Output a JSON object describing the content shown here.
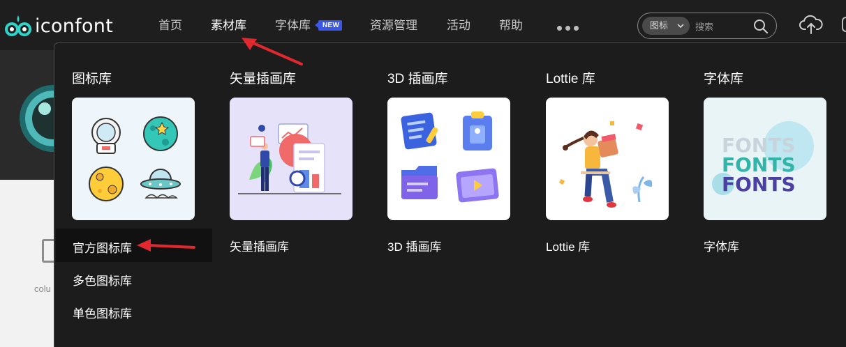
{
  "header": {
    "logo_text": "iconfont",
    "nav": [
      {
        "label": "首页",
        "active": false
      },
      {
        "label": "素材库",
        "active": true
      },
      {
        "label": "字体库",
        "active": false,
        "badge": "NEW"
      },
      {
        "label": "资源管理",
        "active": false
      },
      {
        "label": "活动",
        "active": false
      },
      {
        "label": "帮助",
        "active": false
      }
    ],
    "search": {
      "type_label": "图标",
      "placeholder": "搜索"
    }
  },
  "background_page": {
    "column_text": "colu"
  },
  "dropdown": {
    "columns": [
      {
        "title": "图标库",
        "icon": "icon-library-illustration",
        "links": [
          "官方图标库",
          "多色图标库",
          "单色图标库"
        ]
      },
      {
        "title": "矢量插画库",
        "icon": "vector-illustration",
        "links": [
          "矢量插画库"
        ]
      },
      {
        "title": "3D 插画库",
        "icon": "3d-illustration",
        "links": [
          "3D 插画库"
        ]
      },
      {
        "title": "Lottie 库",
        "icon": "lottie-illustration",
        "links": [
          "Lottie 库"
        ]
      },
      {
        "title": "字体库",
        "icon": "fonts-illustration",
        "links": [
          "字体库"
        ],
        "card_words": [
          "FONTS",
          "FONTS",
          "FONTS"
        ]
      }
    ],
    "highlighted_link": "官方图标库"
  },
  "colors": {
    "accent": "#3a57e8",
    "annotation_arrow": "#e0282e",
    "background": "#1c1c1c"
  }
}
